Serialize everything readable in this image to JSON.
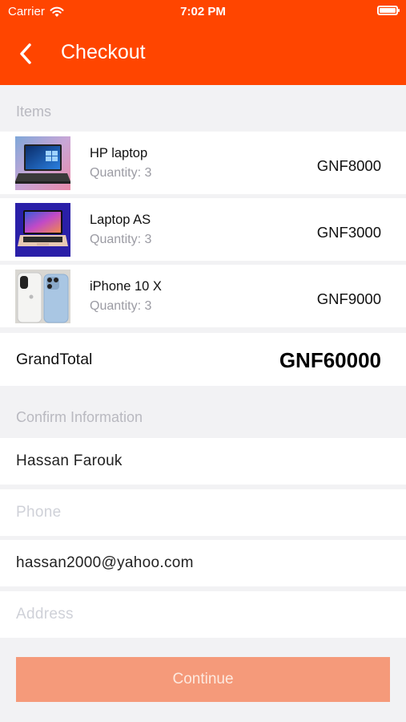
{
  "status_bar": {
    "carrier": "Carrier",
    "time": "7:02 PM"
  },
  "header": {
    "title": "Checkout",
    "back_icon": "chevron-left-icon"
  },
  "items_section": {
    "label": "Items"
  },
  "items": [
    {
      "name": "HP laptop",
      "quantity": "Quantity: 3",
      "price": "GNF8000",
      "image": "hp-laptop-image"
    },
    {
      "name": "Laptop AS",
      "quantity": "Quantity: 3",
      "price": "GNF3000",
      "image": "macbook-image"
    },
    {
      "name": "iPhone 10 X",
      "quantity": "Quantity: 3",
      "price": "GNF9000",
      "image": "iphone-image"
    }
  ],
  "grand_total": {
    "label": "GrandTotal",
    "value": "GNF60000"
  },
  "confirm_section": {
    "label": "Confirm Information"
  },
  "form": {
    "name_value": "Hassan Farouk",
    "phone_placeholder": "Phone",
    "email_value": "hassan2000@yahoo.com",
    "address_placeholder": "Address"
  },
  "continue_label": "Continue",
  "colors": {
    "accent": "#ff4500",
    "button": "#f59a7a",
    "background": "#f2f2f4"
  }
}
